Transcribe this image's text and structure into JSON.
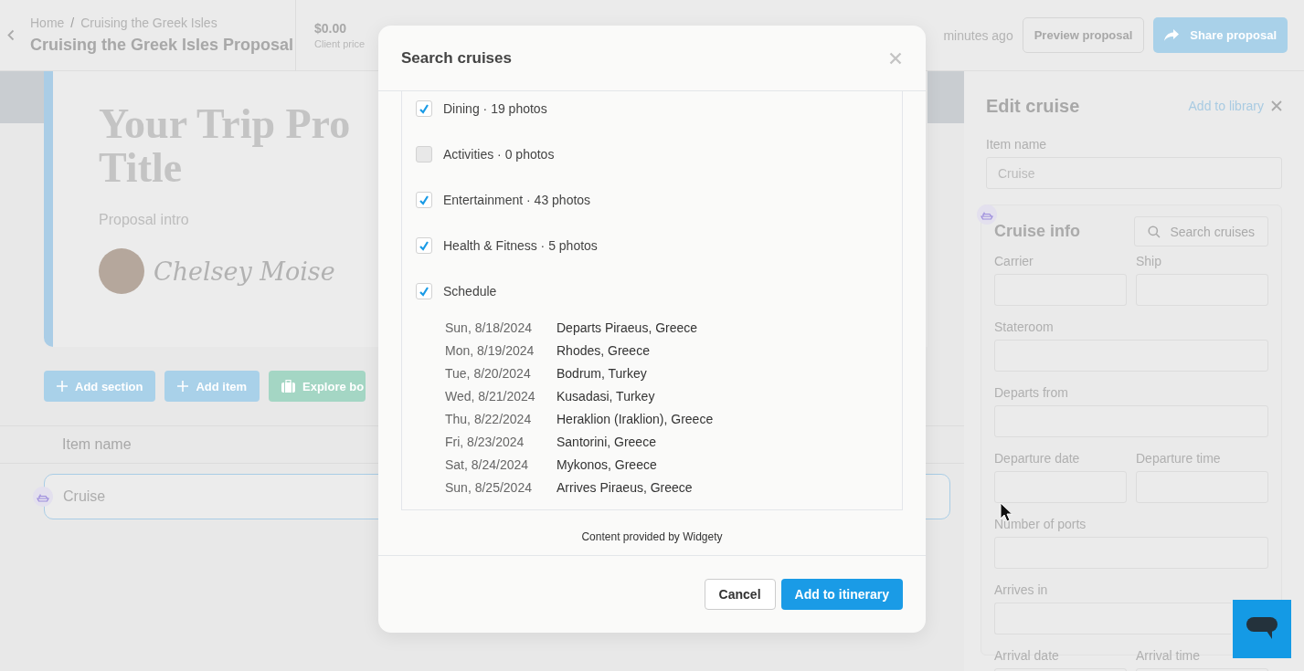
{
  "header": {
    "breadcrumb": [
      "Home",
      "Cruising the Greek Isles"
    ],
    "separator": "/",
    "title": "Cruising the Greek Isles Proposal",
    "price": {
      "value": "$0.00",
      "label": "Client price"
    },
    "saved": "minutes ago",
    "buttons": [
      {
        "label": "Preview proposal",
        "kind": "secondary"
      },
      {
        "label": "Share proposal",
        "kind": "primary"
      }
    ]
  },
  "cover": {
    "title_lines": [
      "Your Trip Pro",
      "Title"
    ],
    "intro": {
      "placeholder": "Proposal intro"
    },
    "signature": "Chelsey Moise"
  },
  "actions": [
    {
      "label": "Add section",
      "kind": "add"
    },
    {
      "label": "Add item",
      "kind": "add"
    },
    {
      "label": "Explore bo",
      "kind": "explore"
    }
  ],
  "items_table": {
    "column": "Item name",
    "rows": [
      {
        "name": "Cruise"
      }
    ]
  },
  "edit_panel": {
    "title": "Edit cruise",
    "library_link": "Add to library",
    "item_name": {
      "label": "Item name",
      "value": "Cruise"
    },
    "cruise_info": {
      "title": "Cruise info",
      "search_button": "Search cruises",
      "fields": [
        {
          "label": "Carrier",
          "kind": "half"
        },
        {
          "label": "Ship",
          "kind": "half"
        },
        {
          "label": "Stateroom",
          "kind": "full"
        },
        {
          "label": "Departs from",
          "kind": "full"
        },
        {
          "label": "Departure date",
          "kind": "half"
        },
        {
          "label": "Departure time",
          "kind": "half"
        },
        {
          "label": "Number of ports",
          "kind": "full"
        },
        {
          "label": "Arrives in",
          "kind": "full"
        },
        {
          "label": "Arrival date",
          "kind": "half"
        },
        {
          "label": "Arrival time",
          "kind": "half"
        }
      ]
    }
  },
  "modal": {
    "title": "Search cruises",
    "options": [
      {
        "label": "Dining · 19 photos",
        "checked": true
      },
      {
        "label": "Activities · 0 photos",
        "checked": false
      },
      {
        "label": "Entertainment · 43 photos",
        "checked": true
      },
      {
        "label": "Health & Fitness · 5 photos",
        "checked": true
      },
      {
        "label": "Schedule",
        "checked": true
      }
    ],
    "schedule": [
      {
        "date": "Sun, 8/18/2024",
        "port": "Departs Piraeus, Greece"
      },
      {
        "date": "Mon, 8/19/2024",
        "port": "Rhodes, Greece"
      },
      {
        "date": "Tue, 8/20/2024",
        "port": "Bodrum, Turkey"
      },
      {
        "date": "Wed, 8/21/2024",
        "port": "Kusadasi, Turkey"
      },
      {
        "date": "Thu, 8/22/2024",
        "port": "Heraklion (Iraklion), Greece"
      },
      {
        "date": "Fri, 8/23/2024",
        "port": "Santorini, Greece"
      },
      {
        "date": "Sat, 8/24/2024",
        "port": "Mykonos, Greece"
      },
      {
        "date": "Sun, 8/25/2024",
        "port": "Arrives Piraeus, Greece"
      }
    ],
    "credit": "Content provided by Widgety",
    "buttons": [
      {
        "label": "Cancel",
        "kind": "secondary"
      },
      {
        "label": "Add to itinerary",
        "kind": "primary"
      }
    ]
  }
}
